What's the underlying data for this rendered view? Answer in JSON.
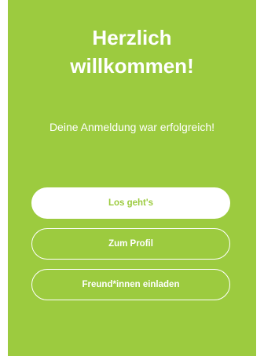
{
  "welcome": {
    "title_line1": "Herzlich",
    "title_line2": "willkommen!",
    "message": "Deine Anmeldung war erfolgreich!"
  },
  "actions": {
    "start_label": "Los geht's",
    "profile_label": "Zum Profil",
    "invite_label": "Freund*innen einladen"
  },
  "colors": {
    "background": "#9ccb3f",
    "text": "#ffffff",
    "primary_button_bg": "#ffffff",
    "primary_button_text": "#9ccb3f"
  }
}
